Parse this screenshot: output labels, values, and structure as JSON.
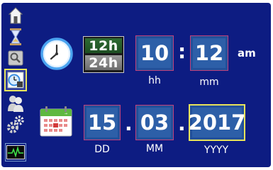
{
  "sidebar": {
    "items": [
      {
        "name": "home"
      },
      {
        "name": "hourglass"
      },
      {
        "name": "search"
      },
      {
        "name": "clock-settings",
        "selected": true
      },
      {
        "name": "users"
      },
      {
        "name": "settings"
      },
      {
        "name": "monitor"
      }
    ]
  },
  "time": {
    "format_selected": "12h",
    "format_other": "24h",
    "hours": "10",
    "separator": ":",
    "minutes": "12",
    "ampm": "am",
    "hours_label": "hh",
    "minutes_label": "mm"
  },
  "date": {
    "day": "15",
    "month": "03",
    "year": "2017",
    "separator": ".",
    "day_label": "DD",
    "month_label": "MM",
    "year_label": "YYYY"
  },
  "colors": {
    "background": "#0d1c82",
    "field": "#2d5fa8",
    "field_border": "#c2417a",
    "selected_outline": "#e8e35a",
    "toggle_on": "#2f6b34",
    "toggle_off": "#8a8a8a"
  },
  "icons": {
    "clock": "clock-icon",
    "calendar": "calendar-icon"
  }
}
